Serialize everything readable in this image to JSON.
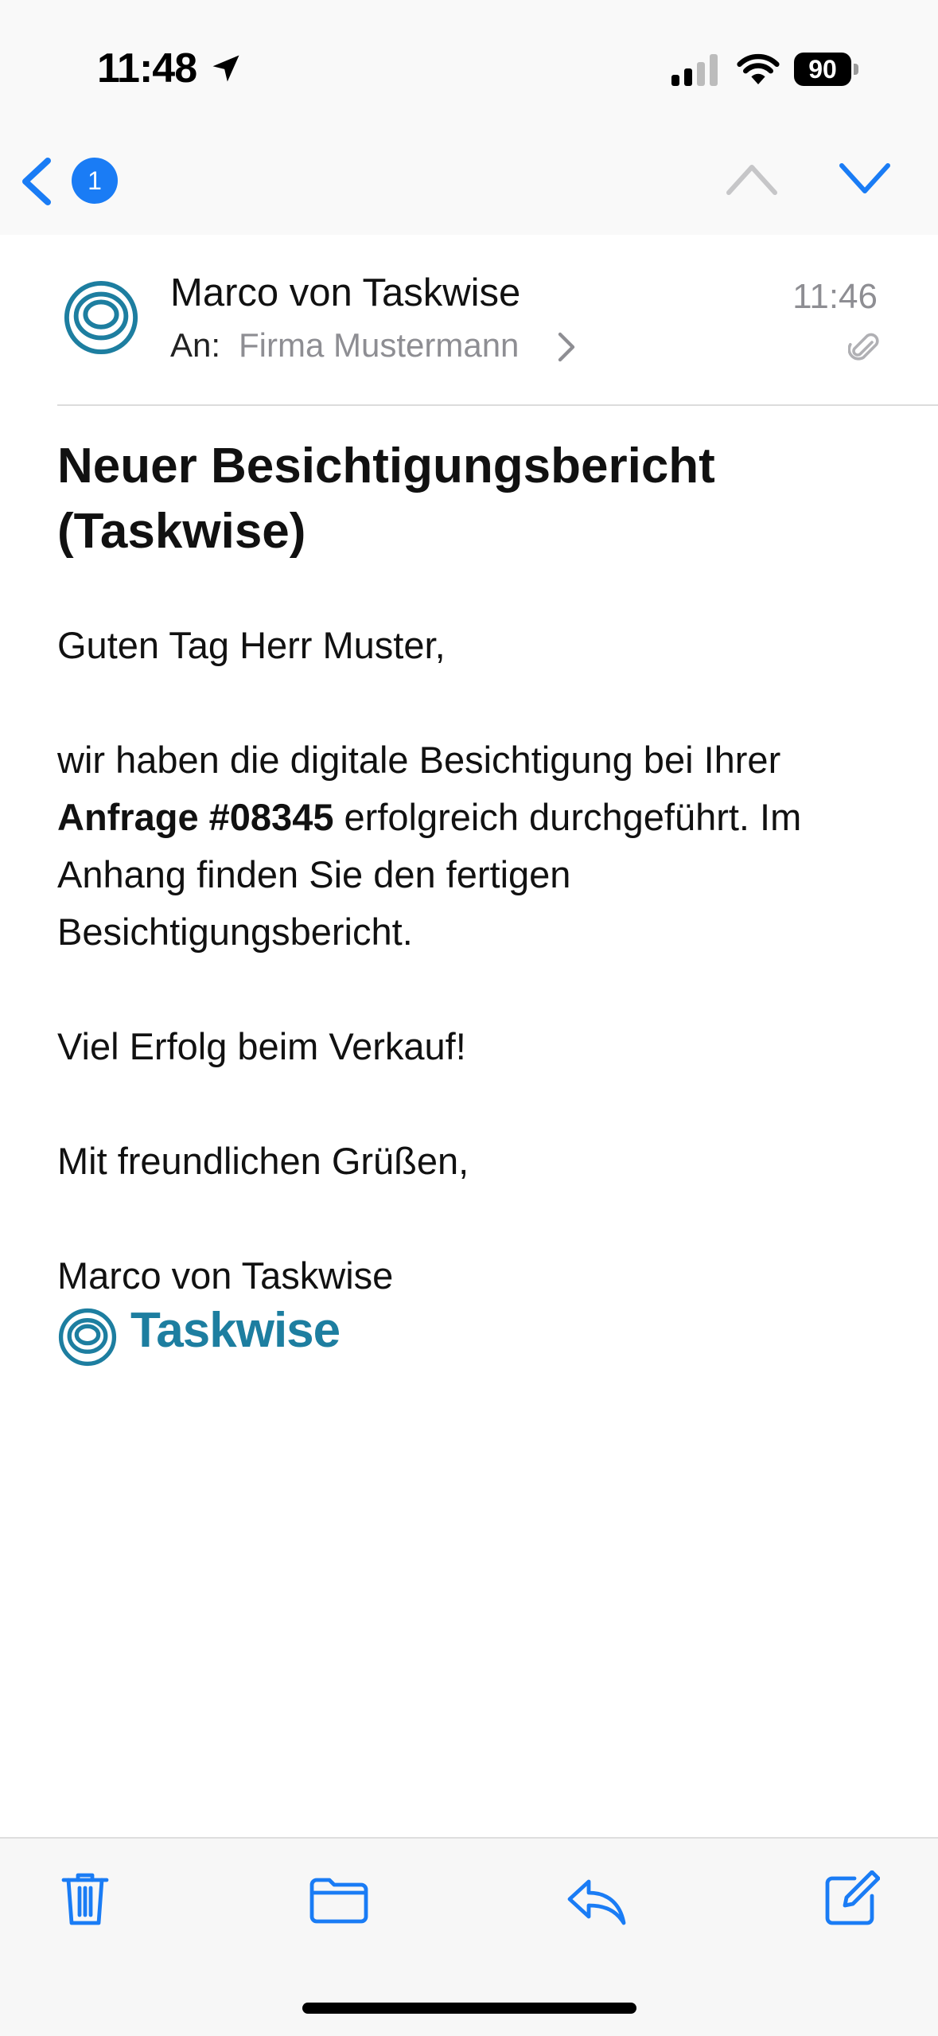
{
  "status_bar": {
    "time": "11:48",
    "battery": "90",
    "icons": [
      "location-arrow-icon",
      "signal-icon",
      "wifi-icon",
      "battery-icon"
    ]
  },
  "nav": {
    "back_icon": "chevron-left-icon",
    "unread_count": "1",
    "prev_icon": "chevron-up-icon",
    "next_icon": "chevron-down-icon"
  },
  "message": {
    "sender": "Marco von Taskwise",
    "to_label": "An:",
    "recipient": "Firma Mustermann",
    "time": "11:46",
    "subject": "Neuer Besichtigungsbericht (Taskwise)",
    "greeting": "Guten Tag Herr Muster,",
    "para1_start": "wir haben die digitale Besichtigung bei Ihrer",
    "para1_bold": "Anfrage #08345",
    "para1_end": " erfolgreich durchgeführt. Im Anhang finden Sie den fertigen Besichtigungsbericht.",
    "para2": "Viel Erfolg beim Verkauf!",
    "closing": "Mit freundlichen Grüßen,",
    "signature": "Marco von Taskwise",
    "logo_text": "Taskwise"
  },
  "toolbar": {
    "icons": [
      "trash-icon",
      "folder-icon",
      "reply-icon",
      "compose-icon"
    ]
  },
  "colors": {
    "accent": "#1a7cf5",
    "brand": "#1d7ea0",
    "secondary_text": "#8e8e93"
  }
}
